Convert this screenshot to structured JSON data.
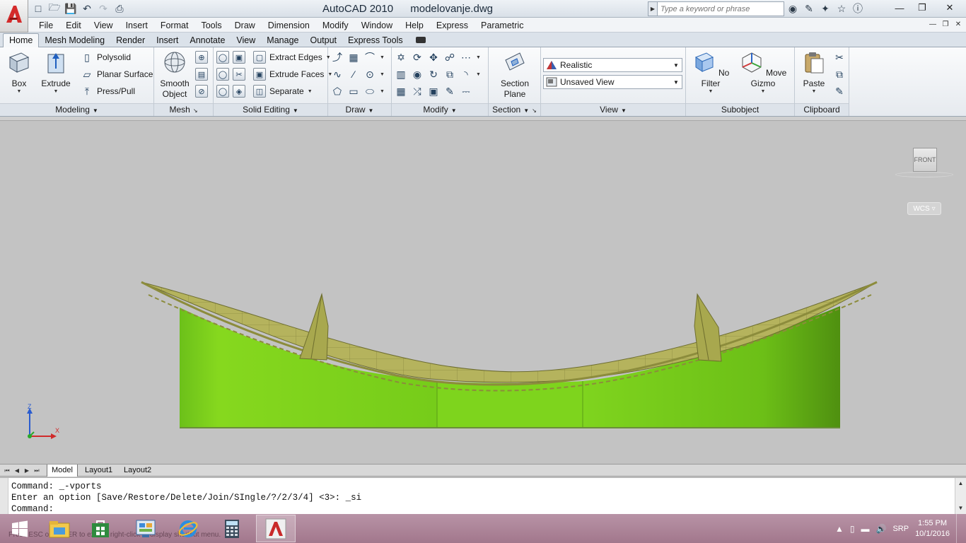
{
  "titlebar": {
    "app_name": "AutoCAD 2010",
    "file_name": "modelovanje.dwg",
    "search_placeholder": "Type a keyword or phrase",
    "qat_icons": [
      "new-icon",
      "open-icon",
      "save-icon",
      "undo-icon",
      "redo-icon",
      "plot-icon"
    ],
    "info_icons": [
      "binoculars-icon",
      "communication-icon",
      "satellite-icon",
      "star-icon",
      "help-icon"
    ]
  },
  "menubar": {
    "items": [
      "File",
      "Edit",
      "View",
      "Insert",
      "Format",
      "Tools",
      "Draw",
      "Dimension",
      "Modify",
      "Window",
      "Help",
      "Express",
      "Parametric"
    ]
  },
  "ribbon_tabs": {
    "items": [
      "Home",
      "Mesh Modeling",
      "Render",
      "Insert",
      "Annotate",
      "View",
      "Manage",
      "Output",
      "Express Tools"
    ],
    "active": "Home"
  },
  "ribbon": {
    "modeling": {
      "label": "Modeling",
      "box": "Box",
      "extrude": "Extrude",
      "polysolid": "Polysolid",
      "planar_surface": "Planar Surface",
      "press_pull": "Press/Pull"
    },
    "mesh": {
      "label": "Mesh",
      "smooth_line1": "Smooth",
      "smooth_line2": "Object"
    },
    "solid_editing": {
      "label": "Solid Editing",
      "extract_edges": "Extract Edges",
      "extrude_faces": "Extrude Faces",
      "separate": "Separate"
    },
    "draw": {
      "label": "Draw"
    },
    "modify": {
      "label": "Modify"
    },
    "section": {
      "label": "Section",
      "btn_line1": "Section",
      "btn_line2": "Plane"
    },
    "view": {
      "label": "View",
      "visual_style": "Realistic",
      "named_view": "Unsaved View"
    },
    "subobject": {
      "label": "Subobject",
      "filter": "No Filter",
      "gizmo": "Move Gizmo"
    },
    "clipboard": {
      "label": "Clipboard",
      "paste": "Paste"
    }
  },
  "viewport": {
    "viewcube_face": "FRONT",
    "wcs": "WCS",
    "ucs_z": "Z",
    "ucs_x": "X",
    "background_color": "#c3c3c3",
    "solid_color": "#6fd11a",
    "roof_color": "#b4b25a"
  },
  "layout_tabs": {
    "items": [
      "Model",
      "Layout1",
      "Layout2"
    ],
    "active": "Model"
  },
  "command": {
    "lines": [
      "Command: _-vports",
      "Enter an option [Save/Restore/Delete/Join/SIngle/?/2/3/4] <3>: _si",
      "Command:"
    ]
  },
  "taskbar": {
    "apps": [
      "windows-start-icon",
      "file-explorer-icon",
      "store-icon",
      "control-panel-icon",
      "internet-explorer-icon",
      "calculator-icon",
      "autocad-icon"
    ],
    "active_app": "autocad-icon",
    "language": "SRP",
    "time": "1:55 PM",
    "date": "10/1/2016",
    "status_ghost": "Press ESC or ENTER to exit, or right-click to display shortcut menu."
  }
}
